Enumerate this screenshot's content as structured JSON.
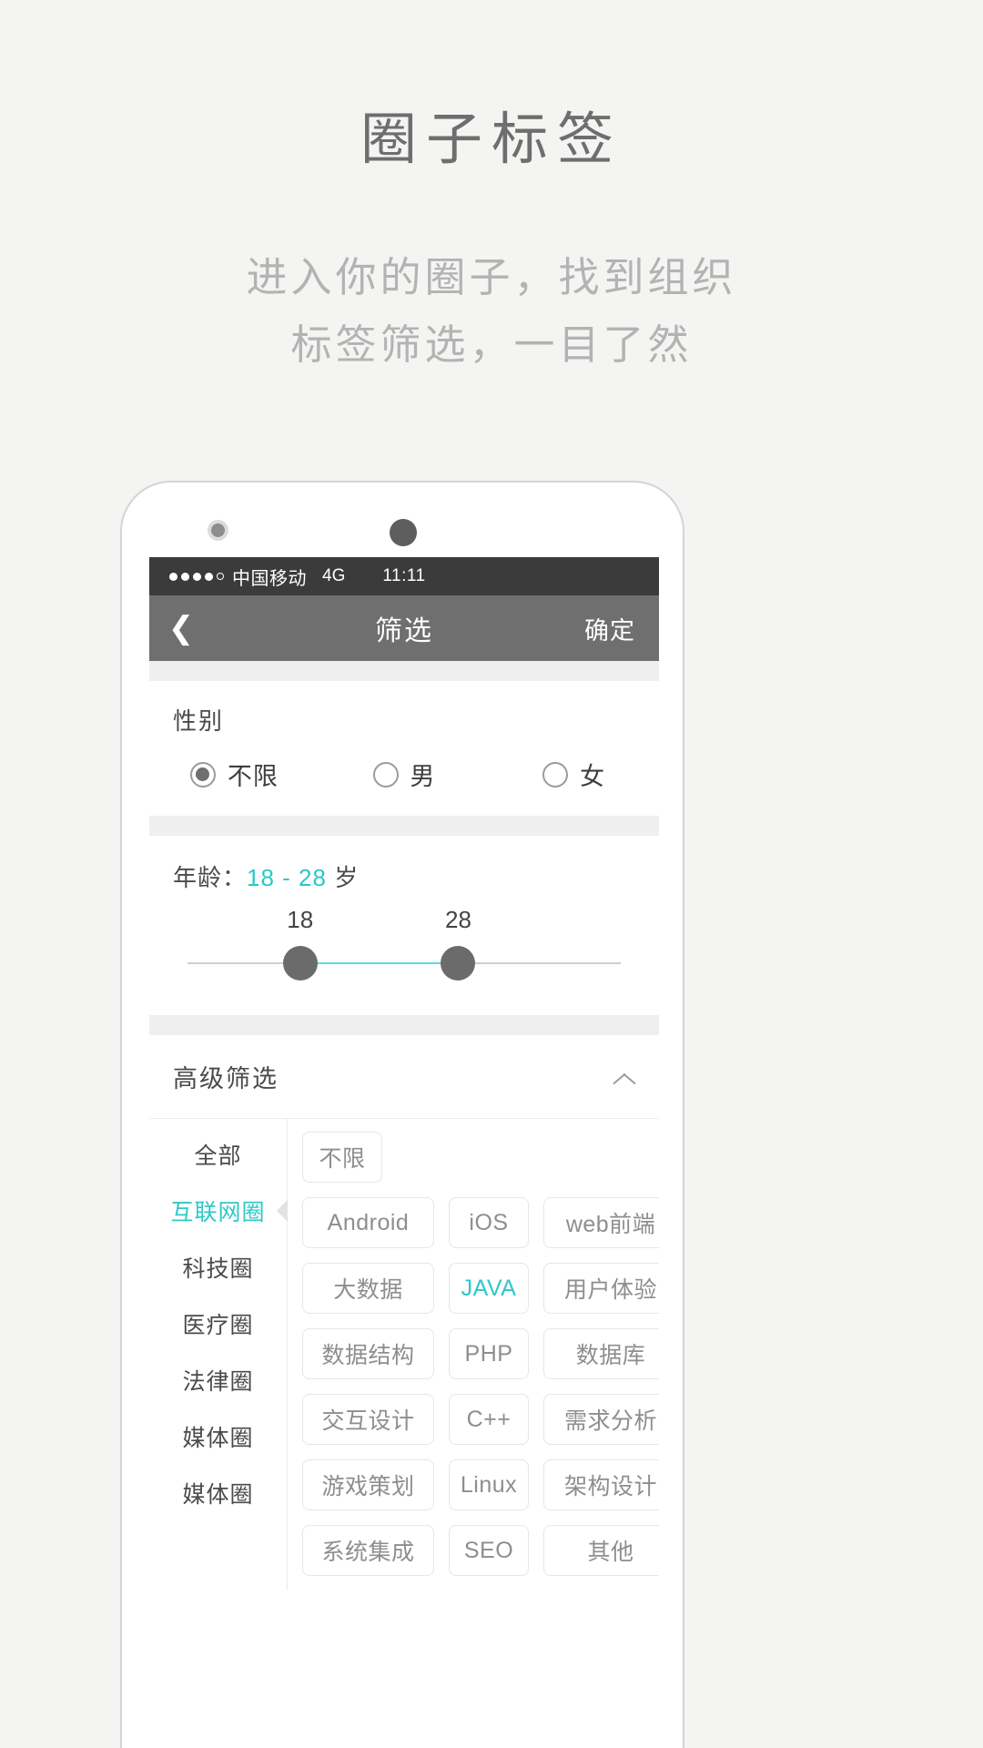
{
  "promo": {
    "title": "圈子标签",
    "subtitle_lines": [
      "进入你的圈子，找到组织",
      "标签筛选，一目了然"
    ]
  },
  "statusbar": {
    "carrier": "中国移动",
    "network": "4G",
    "time": "11:11",
    "signal_dots_filled": 4,
    "signal_dots_total": 5
  },
  "navbar": {
    "back_icon": "chevron-left-icon",
    "title": "筛选",
    "action_label": "确定"
  },
  "gender": {
    "label": "性别",
    "options": [
      {
        "label": "不限",
        "selected": true
      },
      {
        "label": "男",
        "selected": false
      },
      {
        "label": "女",
        "selected": false
      }
    ]
  },
  "age": {
    "label_prefix": "年龄：",
    "range_text": "18 - 28",
    "label_suffix": "岁",
    "min_value": "18",
    "max_value": "28",
    "accent_color": "#29c9c5"
  },
  "advanced": {
    "title": "高级筛选",
    "collapse_icon": "chevron-up-icon",
    "categories": [
      {
        "label": "全部",
        "active": false
      },
      {
        "label": "互联网圈",
        "active": true
      },
      {
        "label": "科技圈",
        "active": false
      },
      {
        "label": "医疗圈",
        "active": false
      },
      {
        "label": "法律圈",
        "active": false
      },
      {
        "label": "媒体圈",
        "active": false
      },
      {
        "label": "媒体圈",
        "active": false
      }
    ],
    "tag_rows": [
      [
        {
          "label": "不限",
          "selected": false,
          "size": "w2"
        }
      ],
      [
        {
          "label": "Android",
          "selected": false,
          "size": "w1"
        },
        {
          "label": "iOS",
          "selected": false,
          "size": "w2"
        },
        {
          "label": "web前端",
          "selected": false,
          "size": "w3"
        }
      ],
      [
        {
          "label": "大数据",
          "selected": false,
          "size": "w1"
        },
        {
          "label": "JAVA",
          "selected": true,
          "size": "w2"
        },
        {
          "label": "用户体验",
          "selected": false,
          "size": "w3"
        }
      ],
      [
        {
          "label": "数据结构",
          "selected": false,
          "size": "w1"
        },
        {
          "label": "PHP",
          "selected": false,
          "size": "w2"
        },
        {
          "label": "数据库",
          "selected": false,
          "size": "w3"
        }
      ],
      [
        {
          "label": "交互设计",
          "selected": false,
          "size": "w1"
        },
        {
          "label": "C++",
          "selected": false,
          "size": "w2"
        },
        {
          "label": "需求分析",
          "selected": false,
          "size": "w3"
        }
      ],
      [
        {
          "label": "游戏策划",
          "selected": false,
          "size": "w1"
        },
        {
          "label": "Linux",
          "selected": false,
          "size": "w2"
        },
        {
          "label": "架构设计",
          "selected": false,
          "size": "w3"
        }
      ],
      [
        {
          "label": "系统集成",
          "selected": false,
          "size": "w1"
        },
        {
          "label": "SEO",
          "selected": false,
          "size": "w2"
        },
        {
          "label": "其他",
          "selected": false,
          "size": "w3"
        }
      ]
    ]
  }
}
